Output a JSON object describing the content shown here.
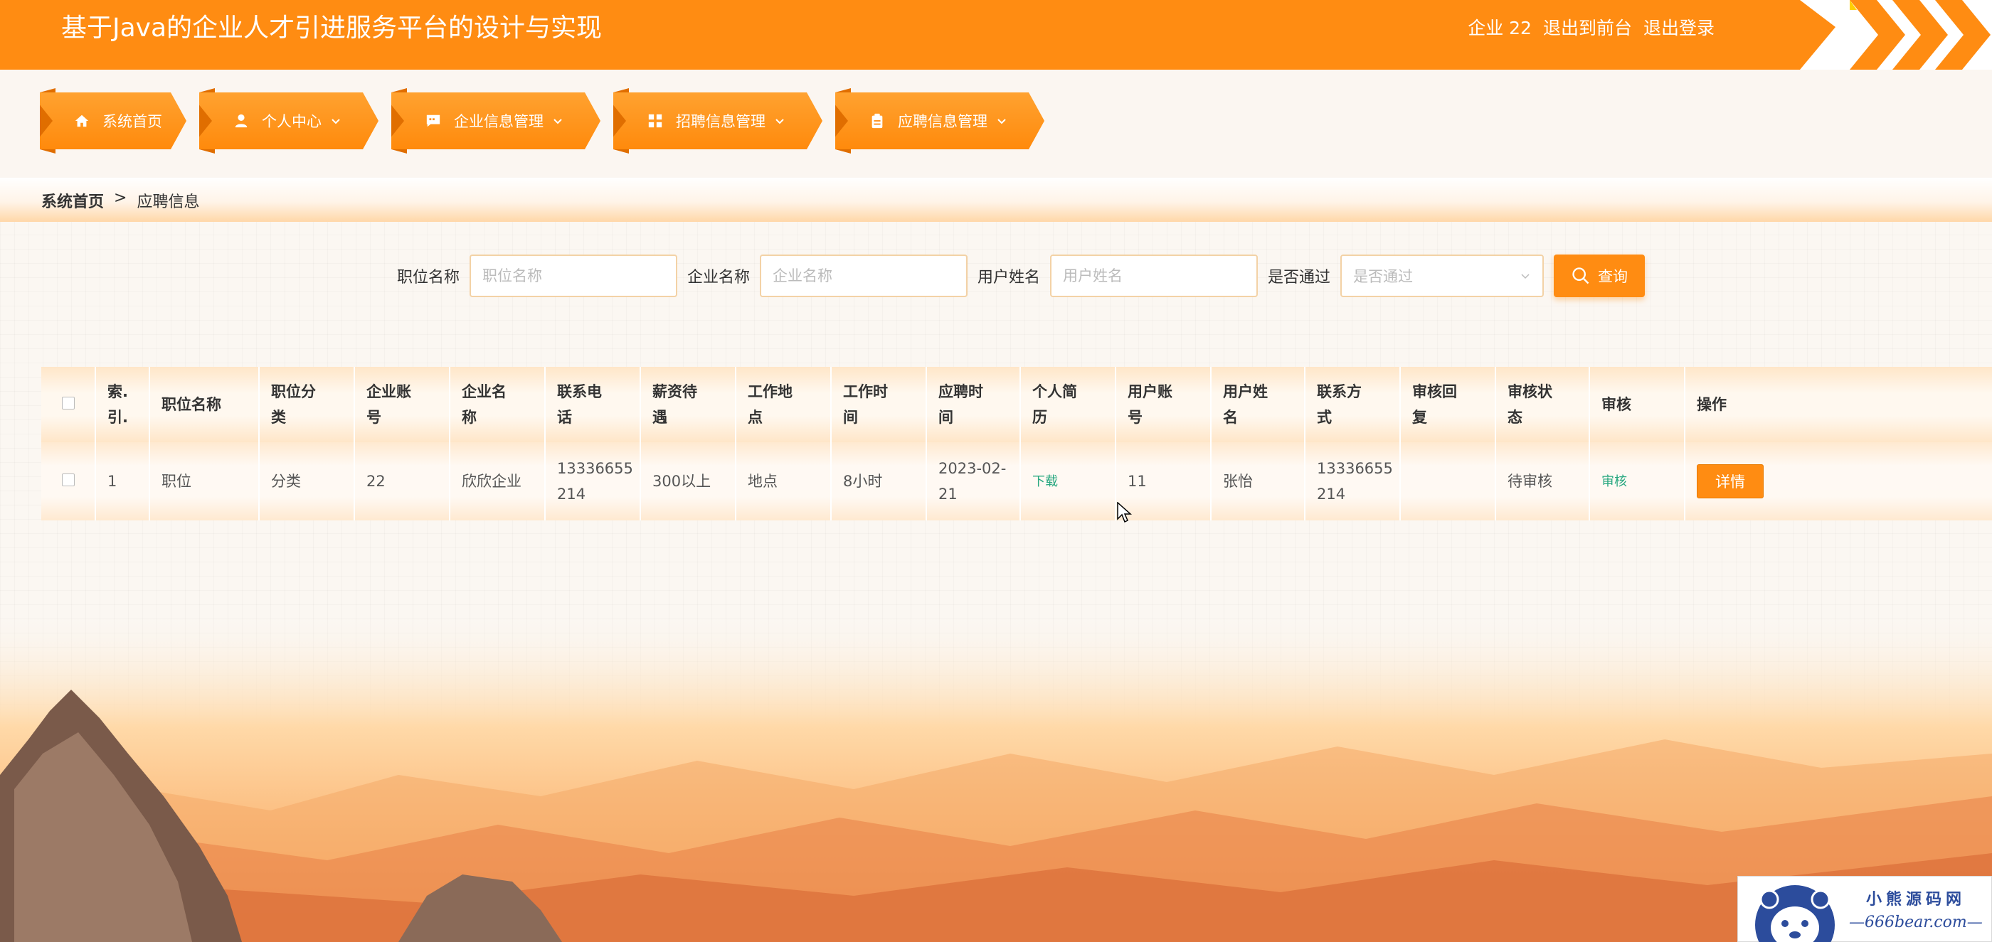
{
  "header": {
    "title": "基于Java的企业人才引进服务平台的设计与实现",
    "user": "企业 22",
    "back_to_front": "退出到前台",
    "logout": "退出登录"
  },
  "nav": {
    "items": [
      {
        "label": "系统首页",
        "icon": "home-icon"
      },
      {
        "label": "个人中心",
        "icon": "user-icon"
      },
      {
        "label": "企业信息管理",
        "icon": "chat-icon"
      },
      {
        "label": "招聘信息管理",
        "icon": "grid-icon"
      },
      {
        "label": "应聘信息管理",
        "icon": "clipboard-icon"
      }
    ]
  },
  "breadcrumb": {
    "home": "系统首页",
    "separator": ">",
    "current": "应聘信息"
  },
  "search": {
    "fields": [
      {
        "label": "职位名称",
        "placeholder": "职位名称"
      },
      {
        "label": "企业名称",
        "placeholder": "企业名称"
      },
      {
        "label": "用户姓名",
        "placeholder": "用户姓名"
      }
    ],
    "select": {
      "label": "是否通过",
      "placeholder": "是否通过"
    },
    "button": "查询"
  },
  "table": {
    "headers": [
      "索.\n引.",
      "职位名称",
      "职位分\n类",
      "企业账\n号",
      "企业名\n称",
      "联系电\n话",
      "薪资待\n遇",
      "工作地\n点",
      "工作时\n间",
      "应聘时\n间",
      "个人简\n历",
      "用户账\n号",
      "用户姓\n名",
      "联系方\n式",
      "审核回\n复",
      "审核状\n态",
      "审核",
      "操作"
    ],
    "rows": [
      {
        "index": "1",
        "job_name": "职位",
        "job_category": "分类",
        "company_account": "22",
        "company_name": "欣欣企业",
        "company_phone": "13336655\n214",
        "salary": "300以上",
        "location": "地点",
        "work_time": "8小时",
        "apply_time": "2023-02-\n21",
        "resume": "下载",
        "user_account": "11",
        "user_name": "张怡",
        "contact": "13336655\n214",
        "review_reply": "",
        "review_status": "待审核",
        "review": "审核",
        "action": "详情"
      }
    ]
  },
  "watermark": {
    "title": "小熊源码网",
    "url": "—666bear.com—"
  },
  "colors": {
    "accent": "#ff8c12",
    "link": "#27a77f"
  }
}
